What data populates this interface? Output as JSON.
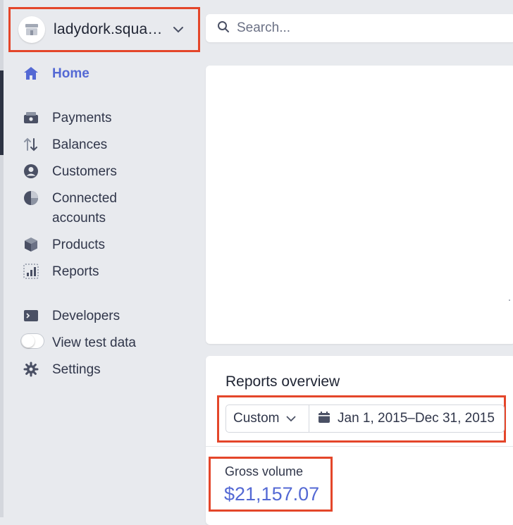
{
  "account": {
    "name": "ladydork.squa…"
  },
  "search": {
    "placeholder": "Search..."
  },
  "nav": {
    "home": "Home",
    "payments": "Payments",
    "balances": "Balances",
    "customers": "Customers",
    "connected_line1": "Connected",
    "connected_line2": "accounts",
    "products": "Products",
    "reports": "Reports",
    "developers": "Developers",
    "view_test_data": "View test data",
    "settings": "Settings"
  },
  "reports_overview": {
    "title": "Reports overview",
    "period_select": "Custom",
    "date_range": "Jan 1, 2015–Dec 31, 2015",
    "gross_volume_label": "Gross volume",
    "gross_volume_value": "$21,157.07"
  },
  "colors": {
    "accent": "#5469d4",
    "highlight": "#e4462a",
    "icon": "#4a5064"
  }
}
